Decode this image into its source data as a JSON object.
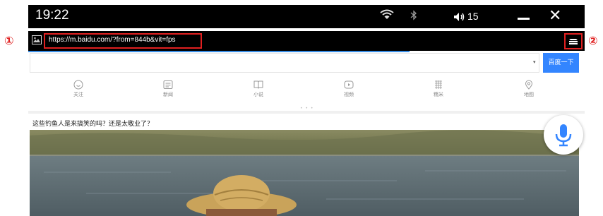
{
  "status_bar": {
    "time": "19:22",
    "volume_level": "15",
    "icons": [
      "wifi-icon",
      "bluetooth-icon",
      "volume-icon",
      "minimize-icon",
      "close-icon"
    ]
  },
  "address_bar": {
    "url": "https://m.baidu.com/?from=844b&vit=fps",
    "markers": [
      "①",
      "②"
    ],
    "icons": [
      "page-icon",
      "menu-icon"
    ]
  },
  "search": {
    "value": "",
    "dropdown_glyph": "▾",
    "button_label": "百度一下"
  },
  "nav_items": [
    {
      "label": "关注",
      "icon": "follow-icon"
    },
    {
      "label": "新闻",
      "icon": "news-icon"
    },
    {
      "label": "小说",
      "icon": "novel-icon"
    },
    {
      "label": "视频",
      "icon": "video-icon"
    },
    {
      "label": "糯米",
      "icon": "nuomi-icon"
    },
    {
      "label": "地图",
      "icon": "map-icon"
    }
  ],
  "page_dots": "• • •",
  "feed": {
    "headline": "这些钓鱼人是来搞笑的吗？还是太敬业了？"
  },
  "voice_button": {
    "icon": "microphone-icon"
  },
  "colors": {
    "accent": "#3385ff",
    "annotation": "#e02020",
    "progress": "#3a8ee6"
  }
}
